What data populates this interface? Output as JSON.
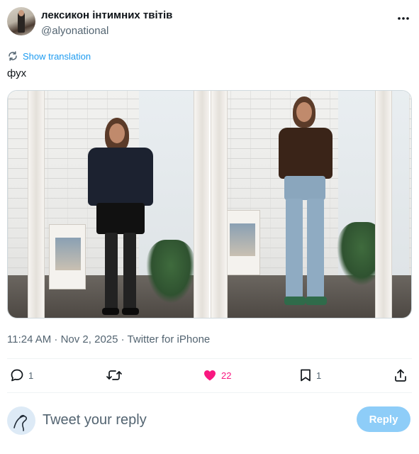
{
  "tweet": {
    "display_name": "лексикон інтимних твітів",
    "handle": "@alyonational",
    "show_translation": "Show translation",
    "text": "фух",
    "timestamp": "11:24 AM · Nov 2, 2025 · Twitter for iPhone"
  },
  "media": {
    "photos": [
      {
        "icon": "mirror-selfie-photo-dark-outfit"
      },
      {
        "icon": "mirror-selfie-photo-jeans-outfit"
      }
    ]
  },
  "actions": {
    "reply_count": "1",
    "retweet_count": "",
    "like_count": "22",
    "bookmark_count": "1"
  },
  "reply": {
    "placeholder": "Tweet your reply",
    "button_label": "Reply"
  },
  "colors": {
    "accent": "#1d9bf0",
    "like": "#f91880",
    "muted": "#536471",
    "reply_button_disabled": "#8ecdf8"
  }
}
